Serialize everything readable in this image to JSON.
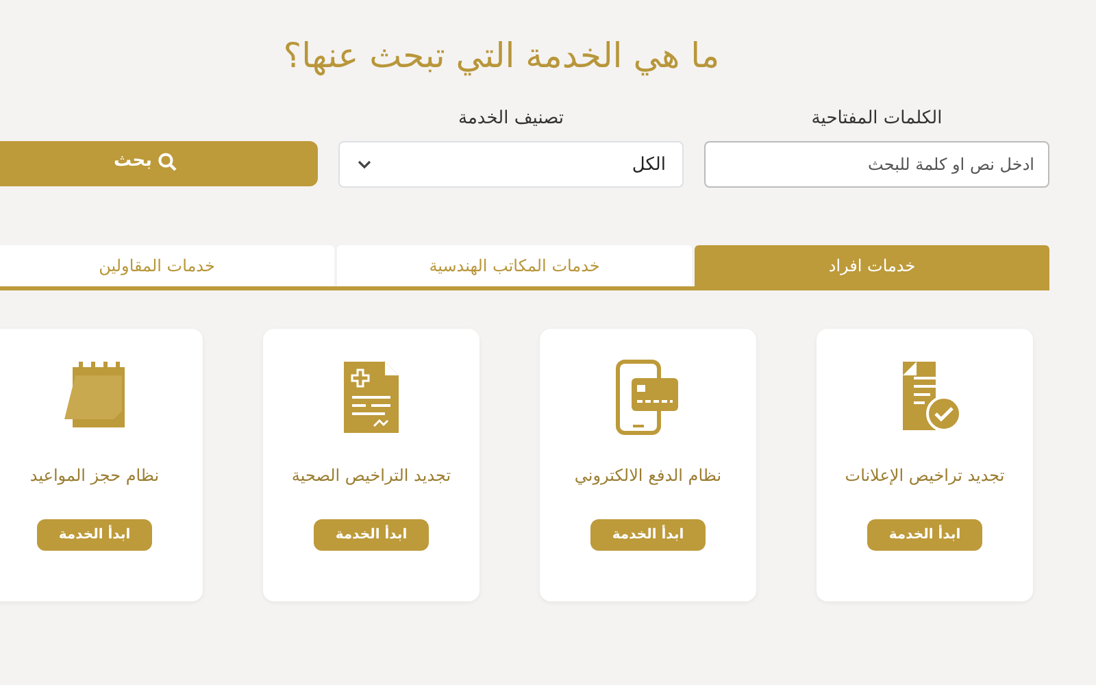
{
  "title": "ما هي الخدمة التي تبحث عنها؟",
  "search": {
    "keywords_label": "الكلمات المفتاحية",
    "placeholder": "ادخل نص او كلمة للبحث",
    "category_label": "تصنيف الخدمة",
    "category_value": "الكل",
    "button": "بحث"
  },
  "tabs": [
    {
      "label": "خدمات افراد",
      "selected": true
    },
    {
      "label": "خدمات المكاتب الهندسية",
      "selected": false
    },
    {
      "label": "خدمات المقاولين",
      "selected": false
    }
  ],
  "services": [
    {
      "kind": "document-check",
      "title": "تجديد تراخيص الإعلانات",
      "button": "ابدأ الخدمة"
    },
    {
      "kind": "phone-card",
      "title": "نظام الدفع الالكتروني",
      "button": "ابدأ الخدمة"
    },
    {
      "kind": "medical-document",
      "title": "تجديد التراخيص الصحية",
      "button": "ابدأ الخدمة"
    },
    {
      "kind": "calendar",
      "title": "نظام حجز المواعيد",
      "button": "ابدأ الخدمة"
    }
  ]
}
